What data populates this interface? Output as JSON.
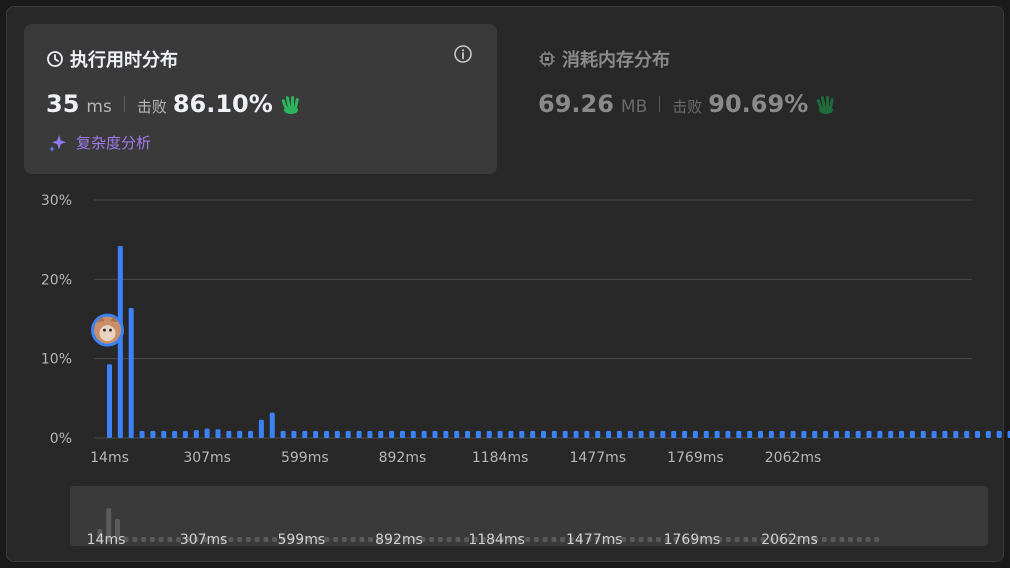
{
  "runtime": {
    "title": "执行用时分布",
    "value": "35",
    "unit": "ms",
    "beat_label": "击败",
    "beat_percent": "86.10%",
    "complexity_link": "复杂度分析"
  },
  "memory": {
    "title": "消耗内存分布",
    "value": "69.26",
    "unit": "MB",
    "beat_label": "击败",
    "beat_percent": "90.69%"
  },
  "colors": {
    "bar": "#3b82f6",
    "hand": "#2db55d",
    "accent": "#9f7aea",
    "navigator_bar": "#5a5a5a"
  },
  "icons": [
    "clock-icon",
    "info-icon",
    "chip-icon",
    "clap-hand-icon",
    "sparkle-icon",
    "user-avatar"
  ],
  "chart_data": {
    "type": "bar",
    "ylim": [
      0,
      30
    ],
    "ytick_labels": [
      "0%",
      "10%",
      "20%",
      "30%"
    ],
    "yticks": [
      0,
      10,
      20,
      30
    ],
    "xtick_labels": [
      "14ms",
      "307ms",
      "599ms",
      "892ms",
      "1184ms",
      "1477ms",
      "1769ms",
      "2062ms"
    ],
    "xtick_bins": [
      0,
      9,
      18,
      27,
      36,
      45,
      54,
      63
    ],
    "values": [
      9.3,
      24.2,
      16.4,
      0.9,
      0.9,
      0.9,
      0.9,
      0.9,
      1.0,
      1.2,
      1.1,
      0.9,
      0.9,
      0.9,
      2.3,
      3.2,
      0.9,
      0.9,
      0.9,
      0.9,
      0.9,
      0.9,
      0.9,
      0.9,
      0.9,
      0.9,
      0.9,
      0.9,
      0.9,
      0.9,
      0.9,
      0.9,
      0.9,
      0.9,
      0.9,
      0.9,
      0.9,
      0.9,
      0.9,
      0.9,
      0.9,
      0.9,
      0.9,
      0.9,
      0.9,
      0.9,
      0.9,
      0.9,
      0.9,
      0.9,
      0.9,
      0.9,
      0.9,
      0.9,
      0.9,
      0.9,
      0.9,
      0.9,
      0.9,
      0.9,
      0.9,
      0.9,
      0.9,
      0.9,
      0.9,
      0.9,
      0.9,
      0.9,
      0.9,
      0.9,
      0.9,
      0.9,
      0.9,
      0.9,
      0.9,
      0.9,
      0.9,
      0.9,
      0.9,
      0.9,
      0.9,
      0.9,
      0.9,
      0.9,
      0.9,
      0.9,
      0.9,
      0.9,
      0.9,
      0.9
    ],
    "current_bin": 0,
    "current_value": 13.6
  }
}
